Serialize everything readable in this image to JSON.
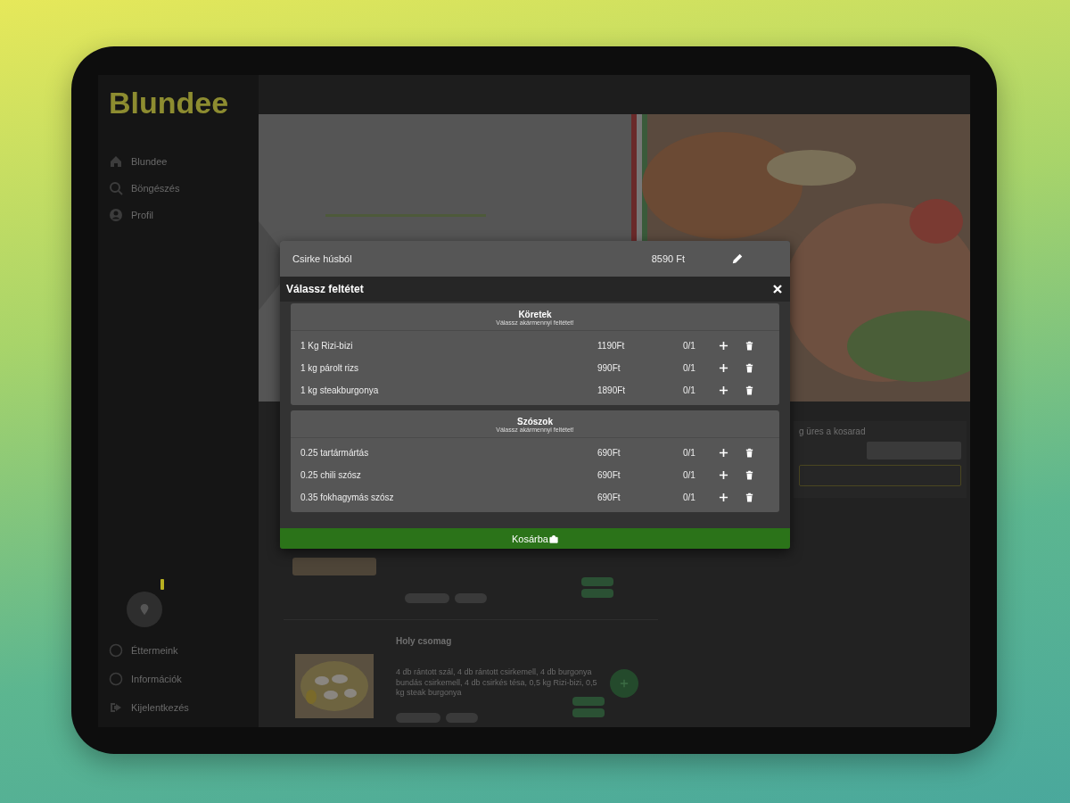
{
  "logo": "Blundee",
  "sidebar": {
    "items": [
      {
        "kind": "home",
        "label": "Blundee"
      },
      {
        "kind": "search",
        "label": "Böngészés"
      },
      {
        "kind": "profile",
        "label": "Profil"
      }
    ],
    "bottom_items": [
      {
        "kind": "info",
        "label": "Éttermeink"
      },
      {
        "kind": "info",
        "label": "Információk"
      },
      {
        "kind": "logout",
        "label": "Kijelentkezés"
      }
    ]
  },
  "menu_items": [
    {
      "kind": "partial"
    },
    {
      "kind": "full",
      "title": "Holy csomag",
      "description": "4 db rántott szál, 4 db rántott csirkemell, 4 db burgonya bundás csirkemell, 4 db csirkés tésa, 0,5 kg Rizi-bizi, 0,5 kg steak burgonya"
    }
  ],
  "cart": {
    "message": "g üres a kosarad"
  },
  "modal": {
    "product": "Csirke húsból",
    "price": "8590 Ft",
    "title": "Válassz feltétet",
    "button": "Kosárba",
    "groups": [
      {
        "name": "Köretek",
        "hint": "Válassz akármennyi feltétet!",
        "options": [
          {
            "name": "1 Kg Rizi-bizi",
            "price": "1190Ft",
            "count": "0/1"
          },
          {
            "name": "1 kg párolt rizs",
            "price": "990Ft",
            "count": "0/1"
          },
          {
            "name": "1 kg steakburgonya",
            "price": "1890Ft",
            "count": "0/1"
          }
        ]
      },
      {
        "name": "Szószok",
        "hint": "Válassz akármennyi feltétet!",
        "options": [
          {
            "name": "0.25 tartármártás",
            "price": "690Ft",
            "count": "0/1"
          },
          {
            "name": "0.25 chili szósz",
            "price": "690Ft",
            "count": "0/1"
          },
          {
            "name": "0.35 fokhagymás szósz",
            "price": "690Ft",
            "count": "0/1"
          }
        ]
      }
    ]
  }
}
